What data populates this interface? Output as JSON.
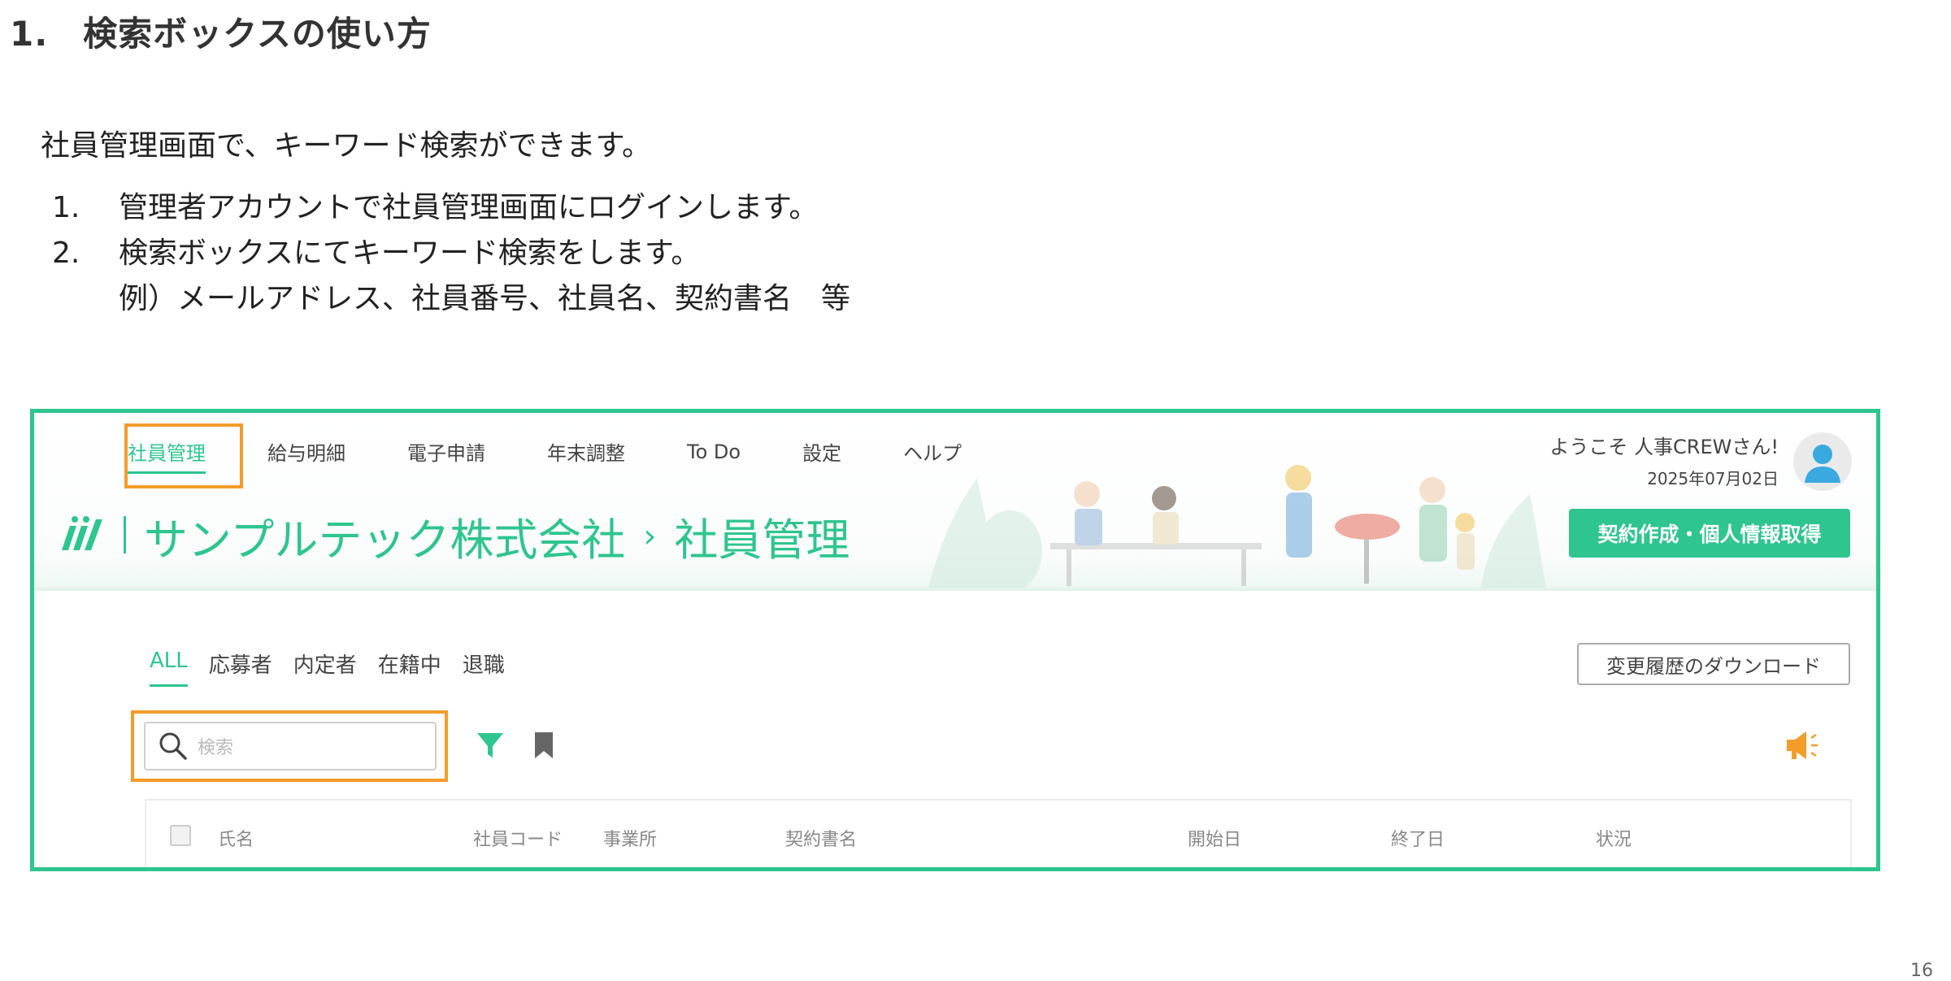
{
  "slide": {
    "title": "1.　検索ボックスの使い方",
    "intro": "社員管理画面で、キーワード検索ができます。",
    "steps": [
      {
        "num": "1.",
        "text": "管理者アカウントで社員管理画面にログインします。"
      },
      {
        "num": "2.",
        "text": "検索ボックスにてキーワード検索をします。"
      }
    ],
    "example": "例）メールアドレス、社員番号、社員名、契約書名　等",
    "page_number": "16"
  },
  "app": {
    "nav": [
      "社員管理",
      "給与明細",
      "電子申請",
      "年末調整",
      "To Do",
      "設定",
      "ヘルプ"
    ],
    "company_name": "サンプルテック株式会社",
    "breadcrumb_separator": "›",
    "page_title": "社員管理",
    "welcome_text": "ようこそ 人事CREWさん!",
    "date": "2025年07月02日",
    "contract_button": "契約作成・個人情報取得",
    "tabs": [
      "ALL",
      "応募者",
      "内定者",
      "在籍中",
      "退職"
    ],
    "download_button": "変更履歴のダウンロード",
    "search_placeholder": "検索",
    "columns": [
      "氏名",
      "社員コード",
      "事業所",
      "契約書名",
      "開始日",
      "終了日",
      "状況"
    ]
  },
  "colors": {
    "accent": "#2ec58f",
    "highlight": "#f39c2a",
    "megaphone": "#f39c2a"
  },
  "icons": {
    "search": "search-icon",
    "filter": "filter-icon",
    "bookmark": "bookmark-icon",
    "announce": "megaphone-icon",
    "avatar": "avatar-icon",
    "logo": "logo-icon"
  }
}
